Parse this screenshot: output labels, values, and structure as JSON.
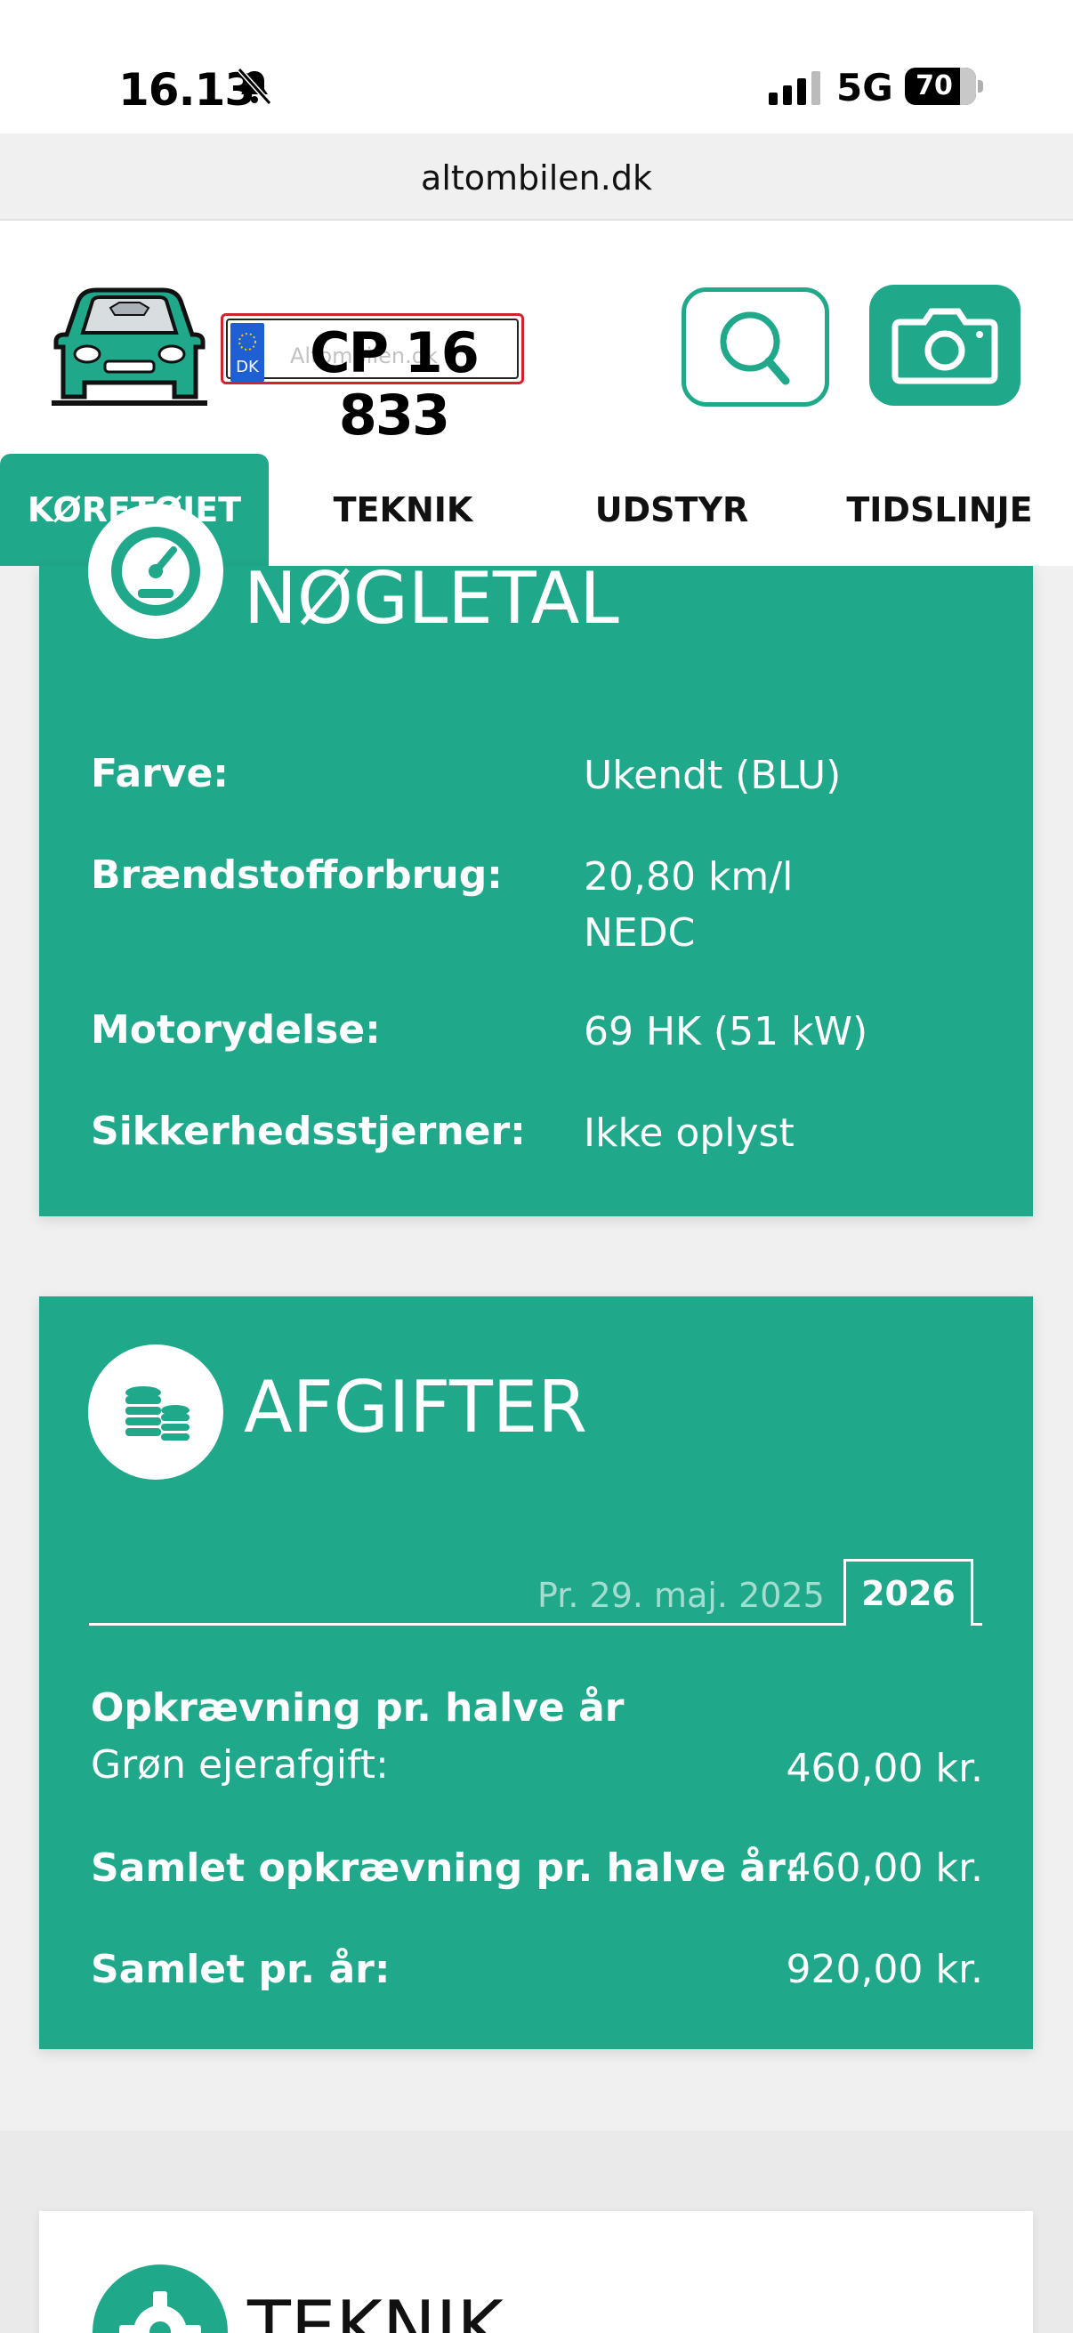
{
  "status_bar": {
    "time": "16.13",
    "network": "5G",
    "battery": "70"
  },
  "browser": {
    "url": "altombilen.dk"
  },
  "header": {
    "plate_country": "DK",
    "plate_number": "CP 16 833",
    "plate_watermark": "Altombilen.dk"
  },
  "tabs": [
    {
      "label": "KØRETØJET",
      "active": true
    },
    {
      "label": "TEKNIK",
      "active": false
    },
    {
      "label": "UDSTYR",
      "active": false
    },
    {
      "label": "TIDSLINJE",
      "active": false
    }
  ],
  "key_figures": {
    "title": "NØGLETAL",
    "rows": [
      {
        "label": "Farve:",
        "value": "Ukendt (BLU)"
      },
      {
        "label": "Brændstofforbrug:",
        "value": "20,80 km/l",
        "value2": "NEDC"
      },
      {
        "label": "Motorydelse:",
        "value": "69 HK (51 kW)"
      },
      {
        "label": "Sikkerhedsstjerner:",
        "value": "Ikke oplyst"
      }
    ]
  },
  "taxes": {
    "title": "AFGIFTER",
    "date_tab": "Pr. 29. maj. 2025",
    "year_tab": "2026",
    "section_heading": "Opkrævning pr. halve år",
    "green_tax_label": "Grøn ejerafgift:",
    "green_tax_value": "460,00 kr.",
    "total_half_label": "Samlet opkrævning pr. halve år:",
    "total_half_value": "460,00 kr.",
    "total_year_label": "Samlet pr. år:",
    "total_year_value": "920,00 kr."
  },
  "technical": {
    "title": "TEKNIK"
  },
  "colors": {
    "accent": "#20a88b",
    "plate_border": "#d0242b"
  }
}
